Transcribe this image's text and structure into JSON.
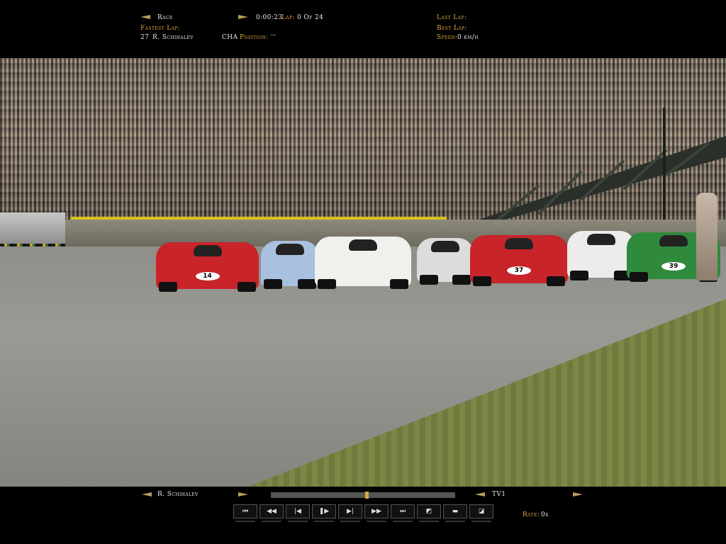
{
  "hud": {
    "session_label": "Race",
    "session_time": "0:00:23",
    "lap_label": "Lap:",
    "lap_value": "0 Of 24",
    "fastest_lap_label": "Fastest Lap:",
    "fastest_lap_driver_number": "27",
    "fastest_lap_driver": "R. Schihalev",
    "driver_abbrev": "CHA",
    "position_label": "Position:",
    "position_value": "--",
    "last_lap_label": "Last Lap:",
    "best_lap_label": "Best Lap:",
    "speed_label": "Speed:",
    "speed_value": "0 km/h"
  },
  "cars": [
    {
      "number": "14",
      "color": "#c8242a"
    },
    {
      "number": "37",
      "color": "#c8242a"
    },
    {
      "number": "39",
      "color": "#2f8a3c"
    }
  ],
  "replay": {
    "driver": "R. Schihalev",
    "camera": "TV1",
    "progress_fraction": 0.52,
    "rate_label": "Rate:",
    "rate_value": "0x",
    "controls": [
      {
        "name": "skip-to-start-button",
        "glyph": "⏮"
      },
      {
        "name": "rewind-button",
        "glyph": "◀◀"
      },
      {
        "name": "step-back-button",
        "glyph": "|◀"
      },
      {
        "name": "pause-play-button",
        "glyph": "❚▶"
      },
      {
        "name": "step-forward-button",
        "glyph": "▶|"
      },
      {
        "name": "fast-forward-button",
        "glyph": "▶▶"
      },
      {
        "name": "skip-to-end-button",
        "glyph": "⏭"
      },
      {
        "name": "view-toggle-button",
        "glyph": "◩"
      },
      {
        "name": "folder-button",
        "glyph": "▬"
      },
      {
        "name": "exit-button",
        "glyph": "◪"
      }
    ]
  }
}
